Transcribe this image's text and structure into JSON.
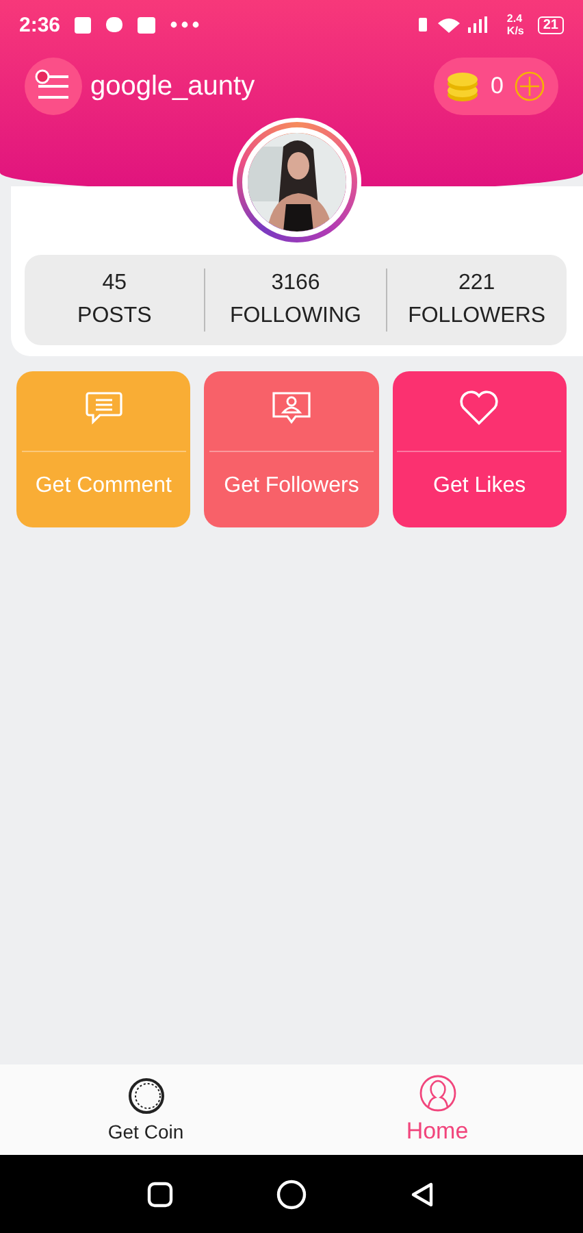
{
  "status_bar": {
    "time": "2:36",
    "speed": "2.4",
    "speed_unit": "K/s",
    "battery": "21"
  },
  "header": {
    "username": "google_aunty",
    "coins": "0"
  },
  "stats": [
    {
      "value": "45",
      "label": "POSTS"
    },
    {
      "value": "3166",
      "label": "FOLLOWING"
    },
    {
      "value": "221",
      "label": "FOLLOWERS"
    }
  ],
  "actions": [
    {
      "kind": "comment",
      "label": "Get Comment",
      "color": "#f9ad35"
    },
    {
      "kind": "followers",
      "label": "Get Followers",
      "color": "#f86169"
    },
    {
      "kind": "likes",
      "label": "Get Likes",
      "color": "#fb3170"
    }
  ],
  "nav": [
    {
      "kind": "coin",
      "label": "Get Coin",
      "selected": false
    },
    {
      "kind": "home",
      "label": "Home",
      "selected": true
    }
  ]
}
